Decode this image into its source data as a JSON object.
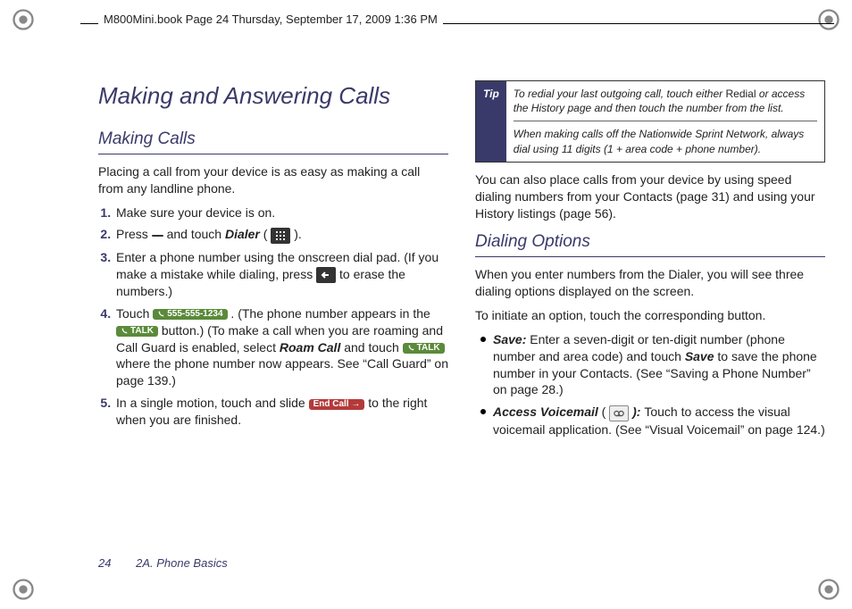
{
  "header": "M800Mini.book  Page 24  Thursday, September 17, 2009  1:36 PM",
  "title": "Making and Answering Calls",
  "subtitle1": "Making Calls",
  "intro1": "Placing a call from your device is as easy as making a call from any landline phone.",
  "steps": {
    "s1": "Make sure your device is on.",
    "s2a": "Press ",
    "s2b": " and touch ",
    "s2_dialer": "Dialer",
    "s2c": " ( ",
    "s2d": " ).",
    "s3a": "Enter a phone number using the onscreen dial pad. (If you make a mistake while dialing, press ",
    "s3b": " to erase the numbers.)",
    "s4a": "Touch ",
    "s4_num": "555-555-1234",
    "s4b": ". (The phone number appears in the ",
    "s4_talk": "TALK",
    "s4c": " button.) (To make a call when you are roaming and Call Guard is enabled, select ",
    "s4_roam": "Roam Call",
    "s4d": " and touch ",
    "s4e": " where the phone number now appears. See “Call Guard” on page 139.)",
    "s5a": "In a single motion, touch and slide ",
    "s5_end": "End Call",
    "s5b": " to the right when you are finished."
  },
  "tip": {
    "label": "Tip",
    "p1a": "To redial your last outgoing call, touch either ",
    "p1_bold": "Redial",
    "p1b": " or access the History page and then touch the number from the list.",
    "p2": "When making calls off the Nationwide Sprint Network, always dial using 11 digits (1 + area code + phone number)."
  },
  "after_tip": "You can also place calls from your device by using speed dialing numbers from your Contacts (page 31) and using your History listings (page 56).",
  "subtitle2": "Dialing Options",
  "do_p1": "When you enter numbers from the Dialer, you will see three dialing options displayed on the screen.",
  "do_p2": "To initiate an option, touch the corresponding button.",
  "bul": {
    "b1_label": "Save:",
    "b1_txt_a": " Enter a seven-digit or ten-digit number (phone number and area code) and touch ",
    "b1_save": "Save",
    "b1_txt_b": " to save the phone number in your Contacts. (See “Saving a Phone Number” on page 28.)",
    "b2_label": "Access Voicemail",
    "b2_txt_a": " ( ",
    "b2_txt_b": " ): ",
    "b2_txt_c": "Touch to access the visual voicemail application. (See “Visual Voicemail” on page 124.)"
  },
  "footer": {
    "page": "24",
    "section": "2A. Phone Basics"
  }
}
